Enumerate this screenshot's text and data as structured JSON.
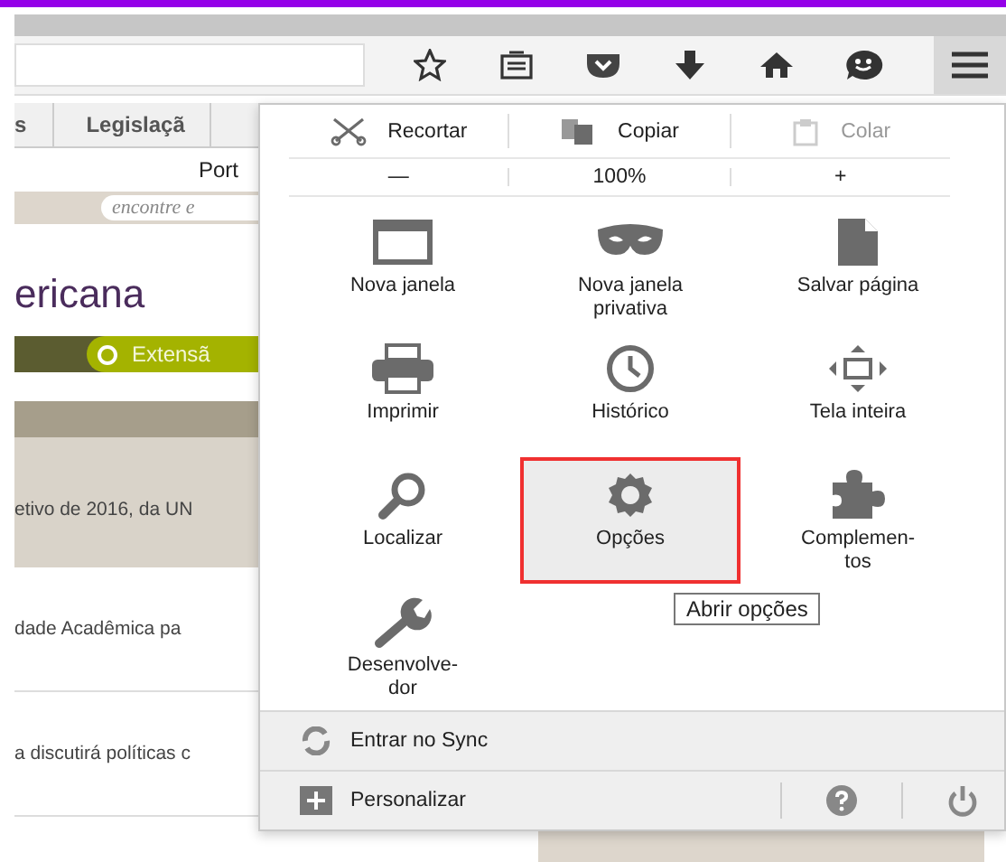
{
  "menu_button": {
    "pressed": true
  },
  "page": {
    "tabs": [
      {
        "label": "s"
      },
      {
        "label": "Legislaçã"
      }
    ],
    "link": "Port",
    "search": {
      "placeholder": "encontre e"
    },
    "heading": "ericana",
    "category": "Extensã",
    "paragraphs": [
      "etivo de 2016, da UN",
      "dade Acadêmica pa",
      "a discutirá políticas c"
    ]
  },
  "menu": {
    "edit": [
      {
        "label": "Recortar",
        "disabled": false
      },
      {
        "label": "Copiar",
        "disabled": false
      },
      {
        "label": "Colar",
        "disabled": true
      }
    ],
    "zoom": {
      "out": "—",
      "level": "100%",
      "in": "+"
    },
    "items": [
      {
        "label": "Nova janela",
        "highlighted": false
      },
      {
        "label": "Nova janela\nprivativa",
        "highlighted": false
      },
      {
        "label": "Salvar página",
        "highlighted": false
      },
      {
        "label": "Imprimir",
        "highlighted": false
      },
      {
        "label": "Histórico",
        "highlighted": false
      },
      {
        "label": "Tela inteira",
        "highlighted": false
      },
      {
        "label": "Localizar",
        "highlighted": false
      },
      {
        "label": "Opções",
        "highlighted": true
      },
      {
        "label": "Complemen-\ntos",
        "highlighted": false
      },
      {
        "label": "Desenvolve-\ndor",
        "highlighted": false
      }
    ],
    "tooltip": "Abrir opções",
    "sync": "Entrar no Sync",
    "customize": "Personalizar"
  }
}
